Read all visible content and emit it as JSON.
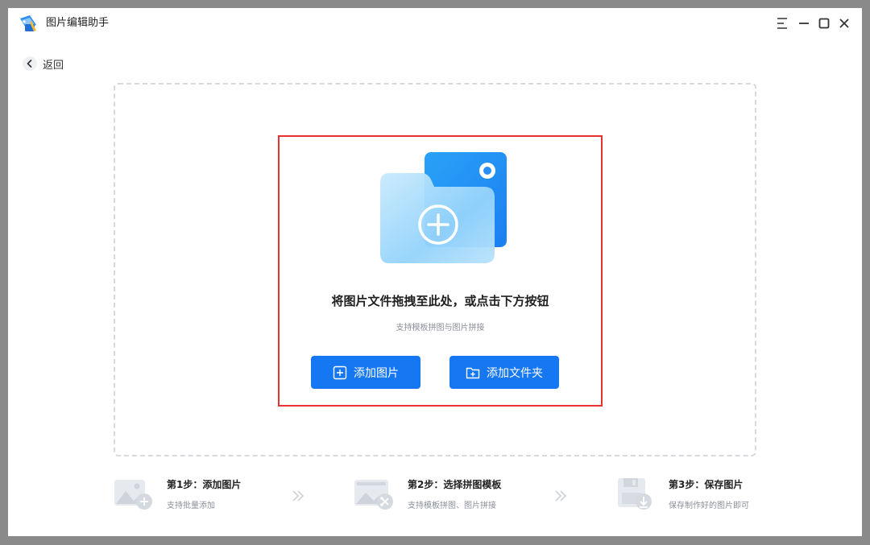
{
  "app": {
    "title": "图片编辑助手"
  },
  "nav": {
    "back_label": "返回"
  },
  "dropzone": {
    "title": "将图片文件拖拽至此处，或点击下方按钮",
    "subtitle": "支持模板拼图与图片拼接",
    "add_image_label": "添加图片",
    "add_folder_label": "添加文件夹"
  },
  "steps": [
    {
      "title": "第1步：添加图片",
      "desc": "支持批量添加"
    },
    {
      "title": "第2步：选择拼图模板",
      "desc": "支持模板拼图、图片拼接"
    },
    {
      "title": "第3步：保存图片",
      "desc": "保存制作好的图片即可"
    }
  ],
  "colors": {
    "accent": "#1677f3",
    "highlight": "#e8322f"
  },
  "icons": [
    "app-logo-icon",
    "menu-icon",
    "minimize-icon",
    "maximize-icon",
    "close-icon",
    "chevron-left-icon",
    "folder-plus-illustration",
    "plus-square-icon",
    "folder-plus-icon",
    "double-chevron-right-icon",
    "image-add-icon",
    "template-icon",
    "save-icon"
  ]
}
